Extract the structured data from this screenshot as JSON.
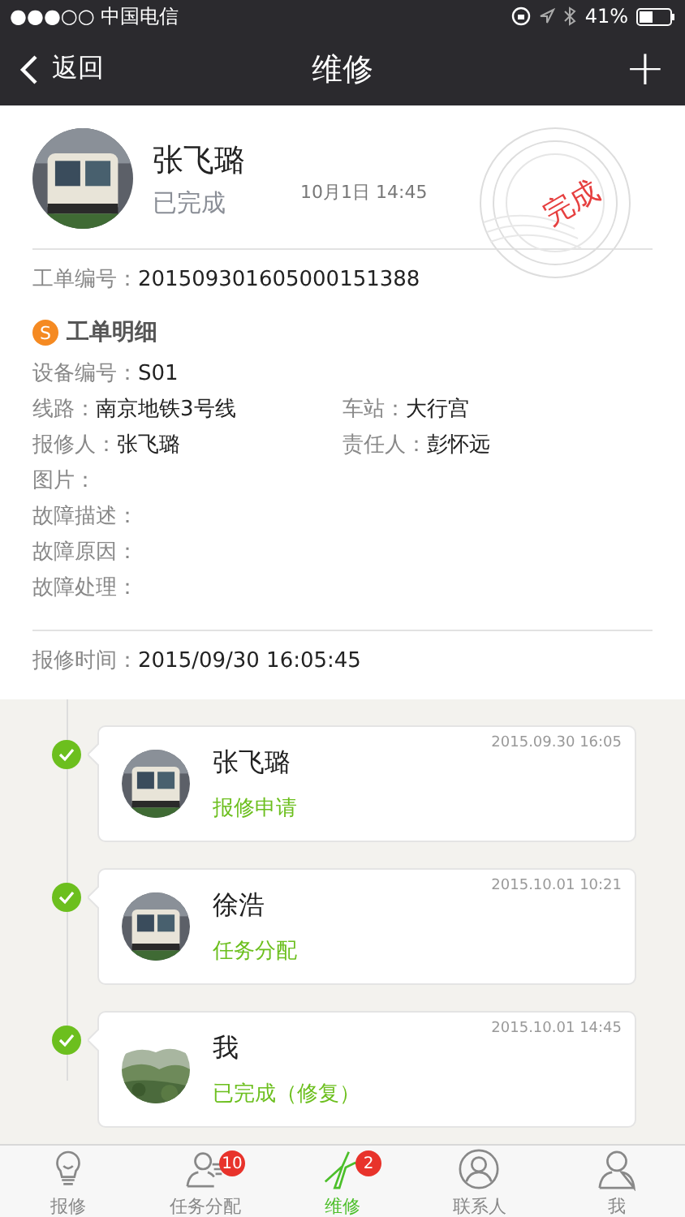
{
  "status_bar": {
    "carrier": "●●●○○ 中国电信",
    "battery": "41%"
  },
  "nav": {
    "back": "返回",
    "title": "维修",
    "add": "+"
  },
  "header": {
    "name": "张飞璐",
    "status": "已完成",
    "time": "10月1日  14:45",
    "stamp": "完成"
  },
  "order": {
    "label": "工单编号：",
    "value": "201509301605000151388"
  },
  "section": {
    "badge": "S",
    "title": "工单明细"
  },
  "fields": [
    {
      "label": "设备编号：",
      "value": "S01"
    },
    {
      "label": "线路：",
      "value": "南京地铁3号线",
      "label2": "车站：",
      "value2": "大行宫"
    },
    {
      "label": "报修人：",
      "value": "张飞璐",
      "label2": "责任人：",
      "value2": "彭怀远"
    },
    {
      "label": "图片："
    },
    {
      "label": "故障描述："
    },
    {
      "label": "故障原因："
    },
    {
      "label": "故障处理："
    }
  ],
  "report_time": {
    "label": "报修时间：",
    "value": "2015/09/30 16:05:45"
  },
  "timeline": [
    {
      "name": "张飞璐",
      "action": "报修申请",
      "time": "2015.09.30 16:05",
      "done": true
    },
    {
      "name": "徐浩",
      "action": "任务分配",
      "time": "2015.10.01 10:21",
      "done": true
    },
    {
      "name": "我",
      "action": "已完成（修复）",
      "time": "2015.10.01 14:45",
      "done": true
    }
  ],
  "tabs": [
    {
      "label": "报修",
      "selected": false
    },
    {
      "label": "任务分配",
      "selected": false,
      "badge": "10"
    },
    {
      "label": "维修",
      "selected": true,
      "badge": "2"
    },
    {
      "label": "联系人",
      "selected": false
    },
    {
      "label": "我",
      "selected": false
    }
  ]
}
